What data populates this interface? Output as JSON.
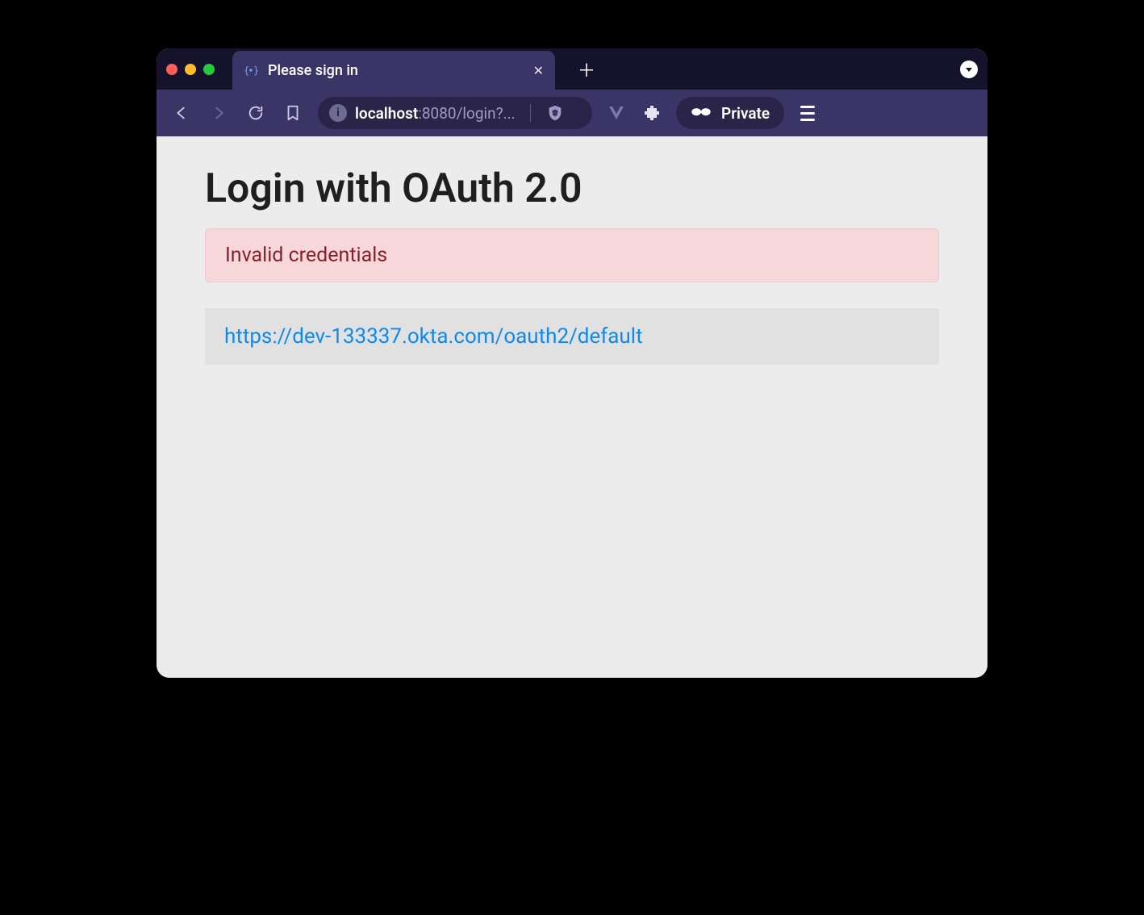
{
  "tab": {
    "title": "Please sign in"
  },
  "toolbar": {
    "url_host": "localhost",
    "url_rest": ":8080/login?...",
    "private_label": "Private"
  },
  "page": {
    "heading": "Login with OAuth 2.0",
    "error_message": "Invalid credentials",
    "provider_link": "https://dev-133337.okta.com/oauth2/default"
  }
}
